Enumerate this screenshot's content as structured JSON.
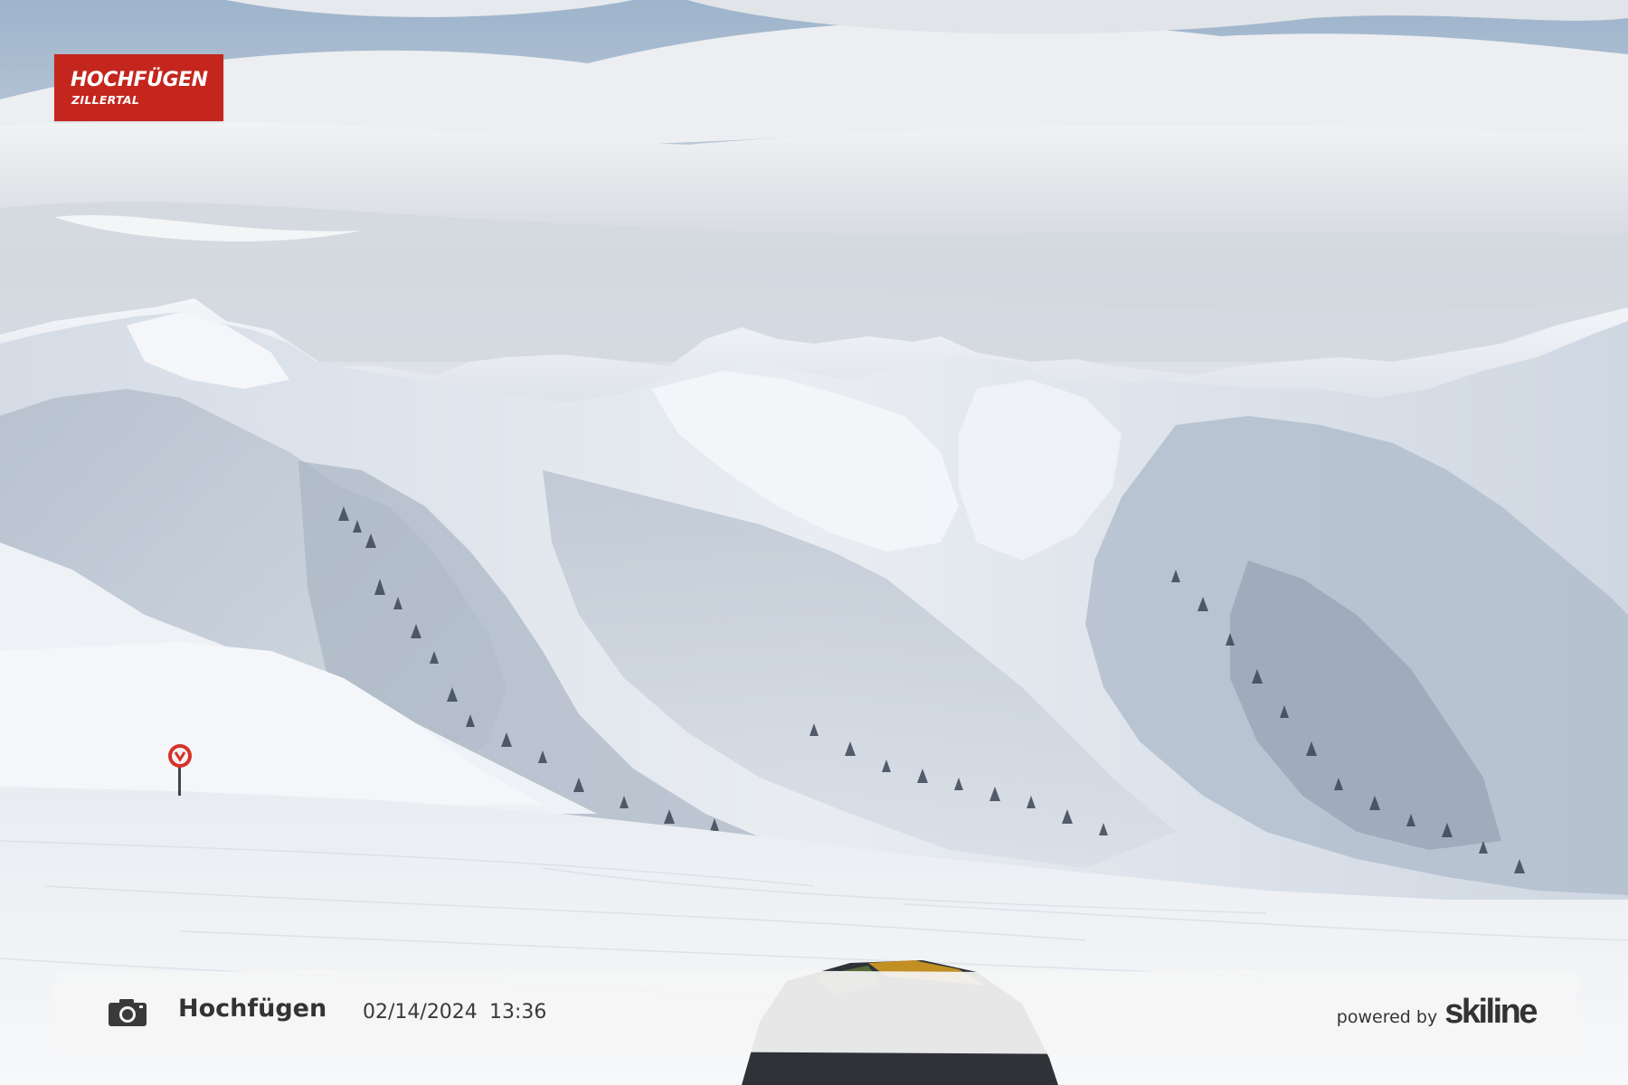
{
  "logo": {
    "line1": "HOCHFÜGEN",
    "line2": "ZILLERTAL",
    "color": "#c4261d"
  },
  "caption": {
    "icon": "camera-icon",
    "place": "Hochfügen",
    "date": "02/14/2024",
    "time": "13:36",
    "powered_by": "powered by",
    "brand": "skiline"
  },
  "scene": {
    "description_icons": [
      "no-entry-sign-icon"
    ]
  }
}
